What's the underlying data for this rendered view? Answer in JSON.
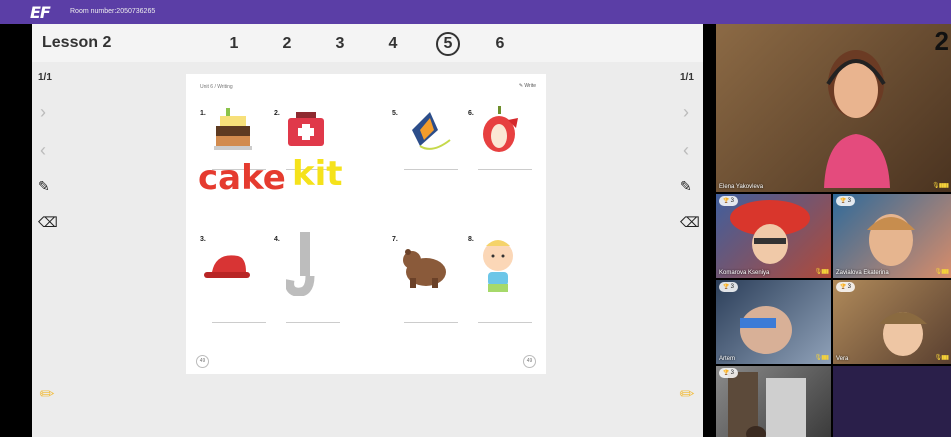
{
  "topbar": {
    "logo": "EF",
    "room": "Room number:2050736265"
  },
  "lesson": {
    "title": "Lesson 2",
    "pages": [
      "1",
      "2",
      "3",
      "4",
      "5",
      "6"
    ],
    "active_page": "5",
    "left_counter": "1/1",
    "right_counter": "1/1"
  },
  "worksheet": {
    "unit_label": "Unit 6 / Writing",
    "tool_label": "Write",
    "items": [
      {
        "num": "1.",
        "picture": "cake"
      },
      {
        "num": "2.",
        "picture": "first-aid-kit"
      },
      {
        "num": "5.",
        "picture": "kite"
      },
      {
        "num": "6.",
        "picture": "apple"
      },
      {
        "num": "3.",
        "picture": "cap"
      },
      {
        "num": "4.",
        "picture": "letter-j"
      },
      {
        "num": "7.",
        "picture": "bear"
      },
      {
        "num": "8.",
        "picture": "baby"
      }
    ],
    "handwriting_1": "cake",
    "handwriting_2": "kit",
    "page_left": "49",
    "page_right": "49",
    "colors": {
      "handwriting_1": "#e53b2f",
      "handwriting_2": "#f5e21b"
    }
  },
  "video": {
    "teacher": {
      "name": "Elena Yakovleva",
      "corner_number": "2"
    },
    "students": [
      {
        "name": "Komarova Kseniya",
        "points": "3"
      },
      {
        "name": "Zavialova Ekaterina",
        "points": "3"
      },
      {
        "name": "Artem",
        "points": "3"
      },
      {
        "name": "Vera",
        "points": "3"
      },
      {
        "name": "",
        "points": "3"
      }
    ]
  }
}
